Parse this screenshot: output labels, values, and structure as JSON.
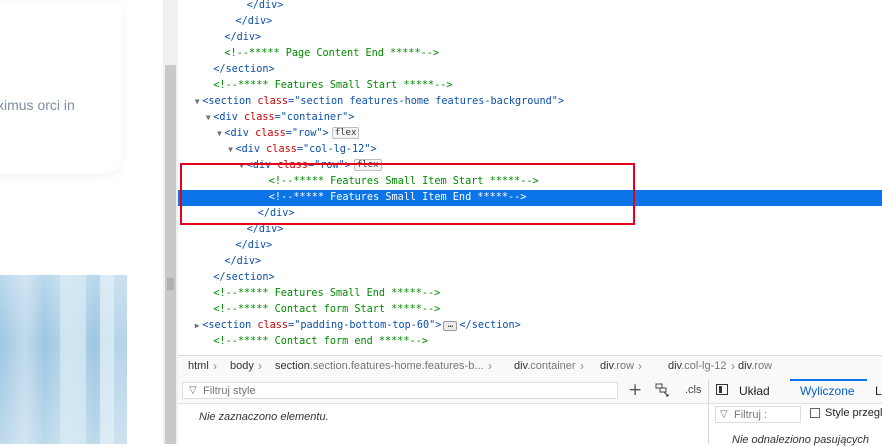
{
  "page": {
    "text_fragment": "ximus orci in"
  },
  "markup": {
    "lines": [
      {
        "indent": 6,
        "twisty": "",
        "parts": [
          [
            "tag",
            "</div>"
          ]
        ]
      },
      {
        "indent": 5,
        "twisty": "",
        "parts": [
          [
            "tag",
            "</div>"
          ]
        ]
      },
      {
        "indent": 4,
        "twisty": "",
        "parts": [
          [
            "tag",
            "</div>"
          ]
        ]
      },
      {
        "indent": 4,
        "twisty": "",
        "parts": [
          [
            "comment",
            "<!--***** Page Content End *****-->"
          ]
        ]
      },
      {
        "indent": 3,
        "twisty": "",
        "parts": [
          [
            "tag",
            "</section>"
          ]
        ]
      },
      {
        "indent": 3,
        "twisty": "",
        "parts": [
          [
            "comment",
            "<!--***** Features Small Start *****-->"
          ]
        ]
      },
      {
        "indent": 2,
        "twisty": "▼",
        "parts": [
          [
            "tag",
            "<section "
          ],
          [
            "attr",
            "class"
          ],
          [
            "eq",
            "="
          ],
          [
            "val",
            "\"section features-home features-background\""
          ],
          [
            "tag",
            ">"
          ]
        ]
      },
      {
        "indent": 3,
        "twisty": "▼",
        "parts": [
          [
            "tag",
            "<div "
          ],
          [
            "attr",
            "class"
          ],
          [
            "eq",
            "="
          ],
          [
            "val",
            "\"container\""
          ],
          [
            "tag",
            ">"
          ]
        ]
      },
      {
        "indent": 4,
        "twisty": "▼",
        "parts": [
          [
            "tag",
            "<div "
          ],
          [
            "attr",
            "class"
          ],
          [
            "eq",
            "="
          ],
          [
            "val",
            "\"row\""
          ],
          [
            "tag",
            ">"
          ]
        ],
        "badge": "flex"
      },
      {
        "indent": 5,
        "twisty": "▼",
        "parts": [
          [
            "tag",
            "<div "
          ],
          [
            "attr",
            "class"
          ],
          [
            "eq",
            "="
          ],
          [
            "val",
            "\"col-lg-12\""
          ],
          [
            "tag",
            ">"
          ]
        ]
      },
      {
        "indent": 6,
        "twisty": "▼",
        "parts": [
          [
            "tag",
            "<div "
          ],
          [
            "attr",
            "class"
          ],
          [
            "eq",
            "="
          ],
          [
            "val",
            "\"row\""
          ],
          [
            "tag",
            ">"
          ]
        ],
        "badge": "flex"
      },
      {
        "indent": 8,
        "twisty": "",
        "parts": [
          [
            "comment",
            "<!--***** Features Small Item Start *****-->"
          ]
        ]
      },
      {
        "indent": 8,
        "twisty": "",
        "parts": [
          [
            "comment",
            "<!--***** Features Small Item End *****-->"
          ]
        ],
        "selected": true
      },
      {
        "indent": 7,
        "twisty": "",
        "parts": [
          [
            "tag",
            "</div>"
          ]
        ]
      },
      {
        "indent": 6,
        "twisty": "",
        "parts": [
          [
            "tag",
            "</div>"
          ]
        ]
      },
      {
        "indent": 5,
        "twisty": "",
        "parts": [
          [
            "tag",
            "</div>"
          ]
        ]
      },
      {
        "indent": 4,
        "twisty": "",
        "parts": [
          [
            "tag",
            "</div>"
          ]
        ]
      },
      {
        "indent": 3,
        "twisty": "",
        "parts": [
          [
            "tag",
            "</section>"
          ]
        ]
      },
      {
        "indent": 3,
        "twisty": "",
        "parts": [
          [
            "comment",
            "<!--***** Features Small End *****-->"
          ]
        ]
      },
      {
        "indent": 3,
        "twisty": "",
        "parts": [
          [
            "comment",
            "<!--***** Contact form Start *****-->"
          ]
        ]
      },
      {
        "indent": 2,
        "twisty": "▶",
        "parts": [
          [
            "tag",
            "<section "
          ],
          [
            "attr",
            "class"
          ],
          [
            "eq",
            "="
          ],
          [
            "val",
            "\"padding-bottom-top-60\""
          ],
          [
            "tag",
            ">"
          ]
        ],
        "ellipsis": true,
        "closing": "</section>"
      },
      {
        "indent": 3,
        "twisty": "",
        "parts": [
          [
            "comment",
            "<!--***** Contact form end *****-->"
          ]
        ]
      }
    ]
  },
  "breadcrumb": [
    {
      "tag": "html",
      "cls": ""
    },
    {
      "tag": "body",
      "cls": ""
    },
    {
      "tag": "section",
      "cls": ".section.features-home.features-b..."
    },
    {
      "tag": "div",
      "cls": ".container"
    },
    {
      "tag": "div",
      "cls": ".row"
    },
    {
      "tag": "div",
      "cls": ".col-lg-12"
    },
    {
      "tag": "div",
      "cls": ".row"
    }
  ],
  "rules": {
    "filter_placeholder": "Filtruj style",
    "add_rule": "+",
    "cls_label": ".cls",
    "empty_message": "Nie zaznaczono elementu."
  },
  "side": {
    "tab_layout": "Układ",
    "tab_computed": "Wyliczone",
    "tab_more": "L",
    "filter_placeholder": "Filtruj :",
    "browser_styles_label": "Style przegla",
    "empty_message": "Nie odnaleziono pasujących"
  },
  "colors": {
    "selection": "#0a74e8",
    "highlight_box": "#e5001c",
    "tag": "#0b4fa8",
    "attr": "#c80000",
    "comment": "#008a00"
  }
}
